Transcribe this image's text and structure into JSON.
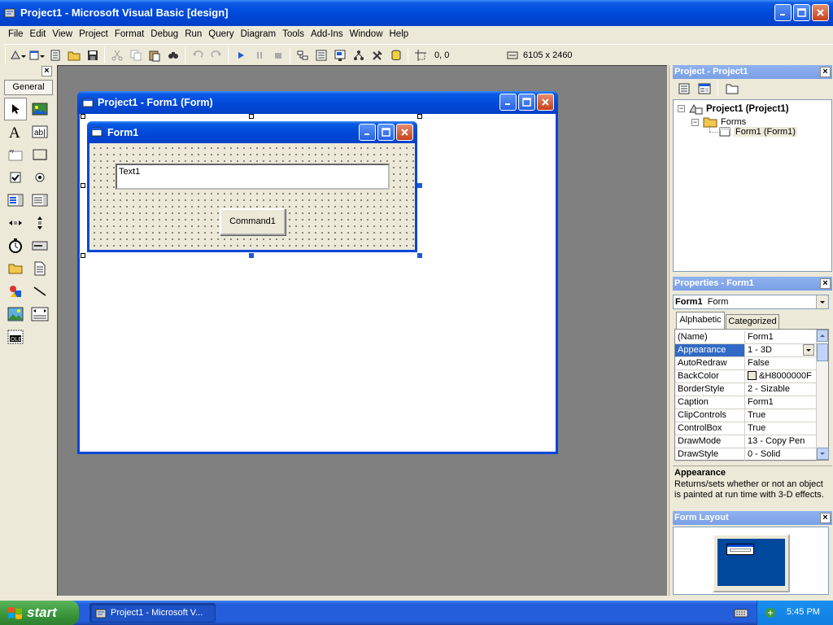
{
  "app": {
    "title": "Project1 - Microsoft Visual Basic [design]"
  },
  "menu": [
    "File",
    "Edit",
    "View",
    "Project",
    "Format",
    "Debug",
    "Run",
    "Query",
    "Diagram",
    "Tools",
    "Add-Ins",
    "Window",
    "Help"
  ],
  "toolbar": {
    "position": "0, 0",
    "size": "6105 x 2460"
  },
  "toolbox": {
    "tab": "General"
  },
  "designer": {
    "window_title": "Project1 - Form1 (Form)",
    "form_caption": "Form1",
    "textbox_text": "Text1",
    "button_caption": "Command1"
  },
  "project_explorer": {
    "title": "Project - Project1",
    "root": "Project1 (Project1)",
    "folder": "Forms",
    "item": "Form1 (Form1)"
  },
  "properties": {
    "title": "Properties - Form1",
    "object_name": "Form1",
    "object_type": "Form",
    "tabs": [
      "Alphabetic",
      "Categorized"
    ],
    "rows": [
      {
        "name": "(Name)",
        "value": "Form1"
      },
      {
        "name": "Appearance",
        "value": "1 - 3D"
      },
      {
        "name": "AutoRedraw",
        "value": "False"
      },
      {
        "name": "BackColor",
        "value": "&H8000000F"
      },
      {
        "name": "BorderStyle",
        "value": "2 - Sizable"
      },
      {
        "name": "Caption",
        "value": "Form1"
      },
      {
        "name": "ClipControls",
        "value": "True"
      },
      {
        "name": "ControlBox",
        "value": "True"
      },
      {
        "name": "DrawMode",
        "value": "13 - Copy Pen"
      },
      {
        "name": "DrawStyle",
        "value": "0 - Solid"
      }
    ],
    "desc_title": "Appearance",
    "desc_text": "Returns/sets whether or not an object is painted at run time with 3-D effects."
  },
  "form_layout": {
    "title": "Form Layout"
  },
  "taskbar": {
    "start": "start",
    "task": "Project1 - Microsoft V...",
    "clock": "5:45 PM"
  },
  "colors": {
    "xp_blue": "#0048d8",
    "workspace": "#808080",
    "taskbar": "#245edb",
    "start_green": "#3c9a3c"
  }
}
